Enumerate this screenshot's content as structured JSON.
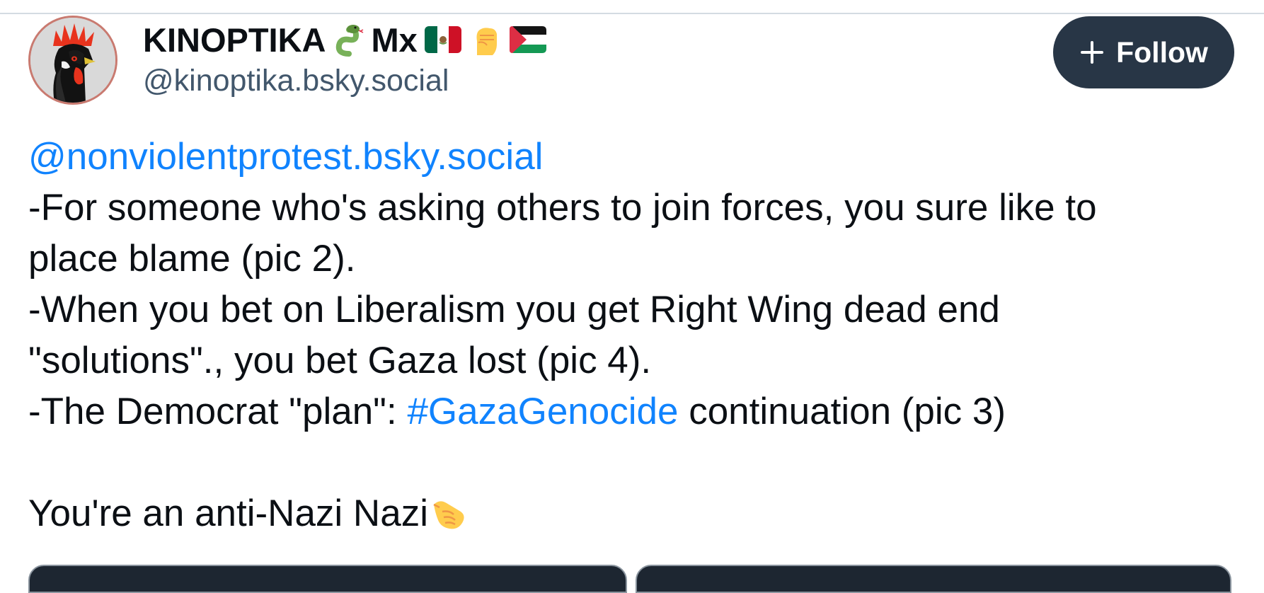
{
  "author": {
    "display_name": "KINOPTIKA",
    "display_name_suffix": "Mx",
    "name_emojis": [
      "snake-emoji",
      "mexico-flag-emoji",
      "raised-fist-emoji",
      "palestine-flag-emoji"
    ],
    "handle": "@kinoptika.bsky.social",
    "avatar": "rooster-avatar"
  },
  "follow_button": {
    "label": "Follow",
    "icon": "plus-icon",
    "color": "#283646"
  },
  "post": {
    "mention": "@nonviolentprotest.bsky.social",
    "line1": "-For someone who's asking others to join forces, you sure like to",
    "line2": "place blame (pic 2).",
    "line3": "-When you bet on Liberalism you get Right Wing dead end",
    "line4": "\"solutions\"., you bet Gaza lost (pic 4).",
    "line5_prefix": "-The Democrat \"plan\": ",
    "hashtag": "#GazaGenocide",
    "line5_suffix": " continuation (pic 3)",
    "line7": "You're an anti-Nazi Nazi",
    "line7_emoji": "pointing-hand-emoji"
  },
  "colors": {
    "link": "#1083fe",
    "text": "#0b0f14",
    "handle": "#42576c"
  },
  "media": {
    "tiles": [
      "image-1",
      "image-2"
    ]
  }
}
